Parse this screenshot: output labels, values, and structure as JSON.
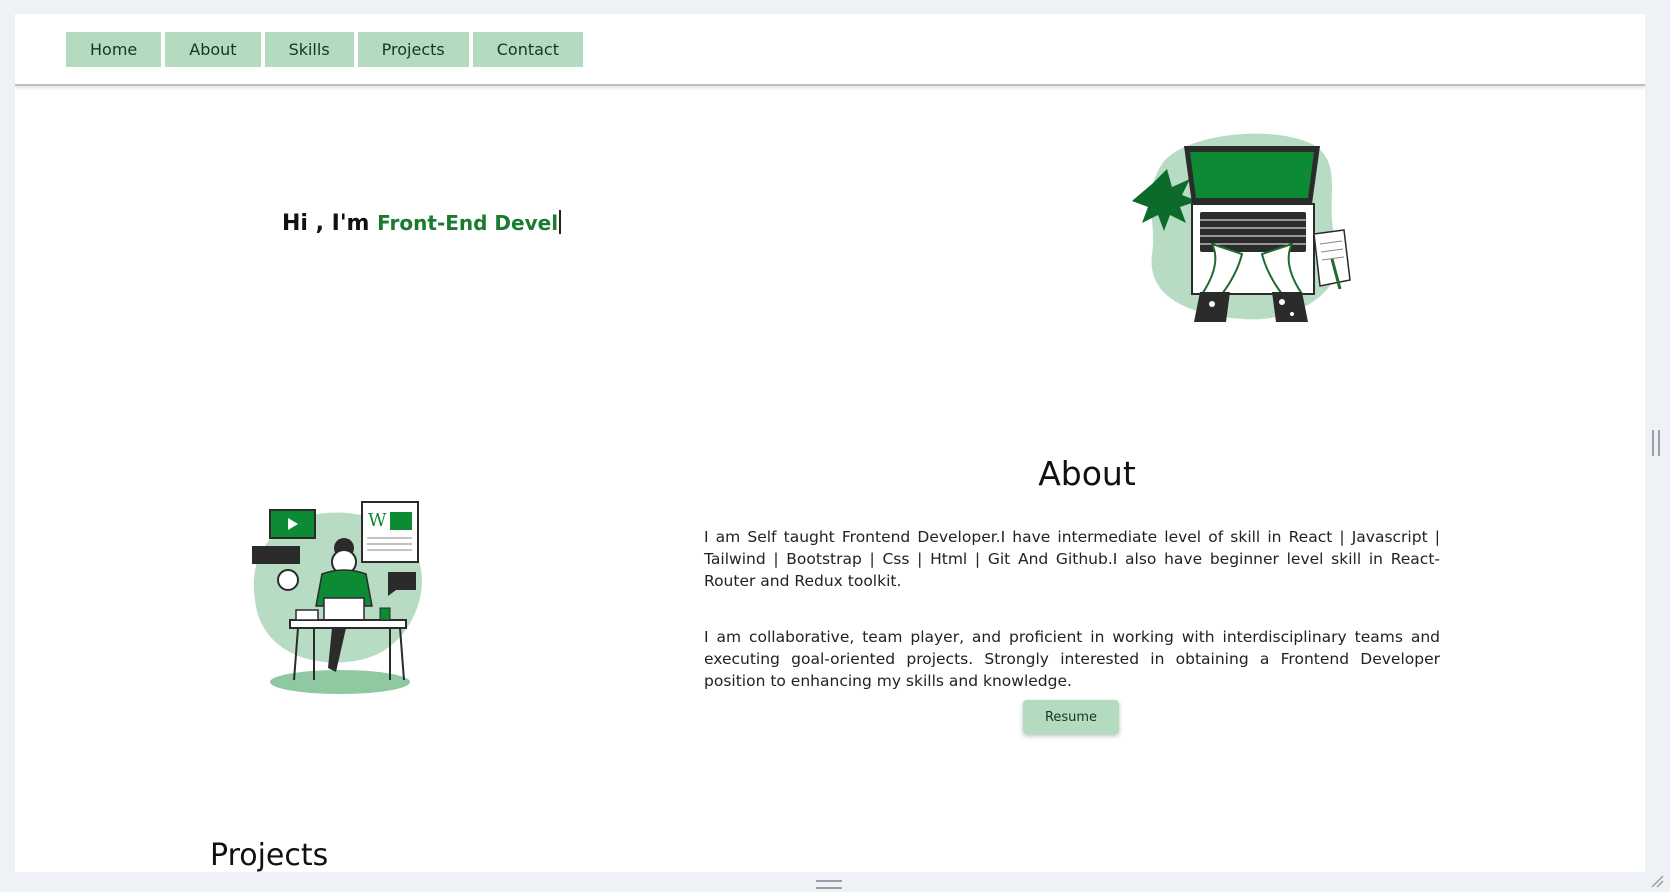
{
  "nav": {
    "items": [
      {
        "label": "Home"
      },
      {
        "label": "About"
      },
      {
        "label": "Skills"
      },
      {
        "label": "Projects"
      },
      {
        "label": "Contact"
      }
    ]
  },
  "hero": {
    "greeting": "Hi , I'm",
    "role_typed": "Front-End Devel",
    "illustration_icon": "laptop-typing-illustration"
  },
  "about": {
    "title": "About",
    "paragraph1": "I am Self taught Frontend Developer.I have intermediate level of skill in React | Javascript | Tailwind | Bootstrap | Css | Html | Git And Github.I also have beginner level skill in React-Router and Redux toolkit.",
    "paragraph2": "I am collaborative, team player, and proficient in working with interdisciplinary teams and executing goal-oriented projects. Strongly interested in obtaining a Frontend Developer position to enhancing my skills and knowledge.",
    "resume_label": "Resume",
    "illustration_icon": "developer-desk-illustration"
  },
  "projects": {
    "title": "Projects"
  },
  "colors": {
    "accent": "#b3dbbf",
    "accent_dark": "#1a7a2e",
    "illustration_green": "#0c8a34",
    "blob": "#b8dcc3"
  }
}
